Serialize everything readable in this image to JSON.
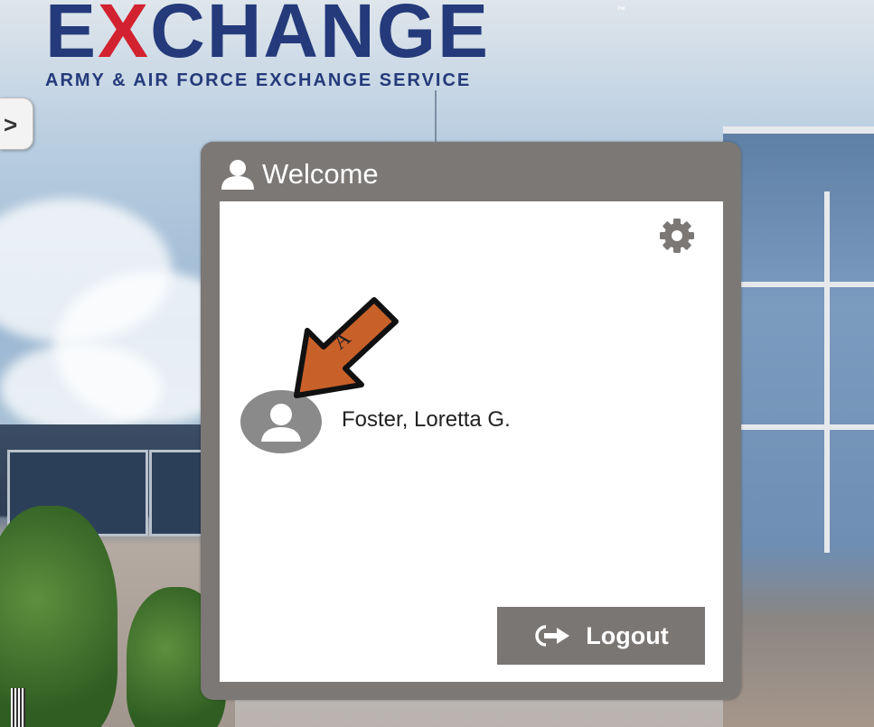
{
  "logo": {
    "word_part1": "E",
    "word_x": "X",
    "word_part2": "CHANGE",
    "trademark": "™",
    "subtitle": "ARMY & AIR FORCE EXCHANGE SERVICE"
  },
  "side_toggle": {
    "glyph": ">"
  },
  "welcome_panel": {
    "title": "Welcome",
    "user_name": "Foster, Loretta G.",
    "logout_label": "Logout"
  },
  "annotation": {
    "label": "A",
    "color": "#c8602a"
  },
  "colors": {
    "logo_blue": "#243a7a",
    "logo_red": "#d22230",
    "panel_gray": "#7b7876",
    "avatar_gray": "#8a8a8a"
  },
  "icons": {
    "header": "user-icon",
    "settings": "gear-icon",
    "avatar": "user-avatar-icon",
    "logout": "logout-icon"
  }
}
